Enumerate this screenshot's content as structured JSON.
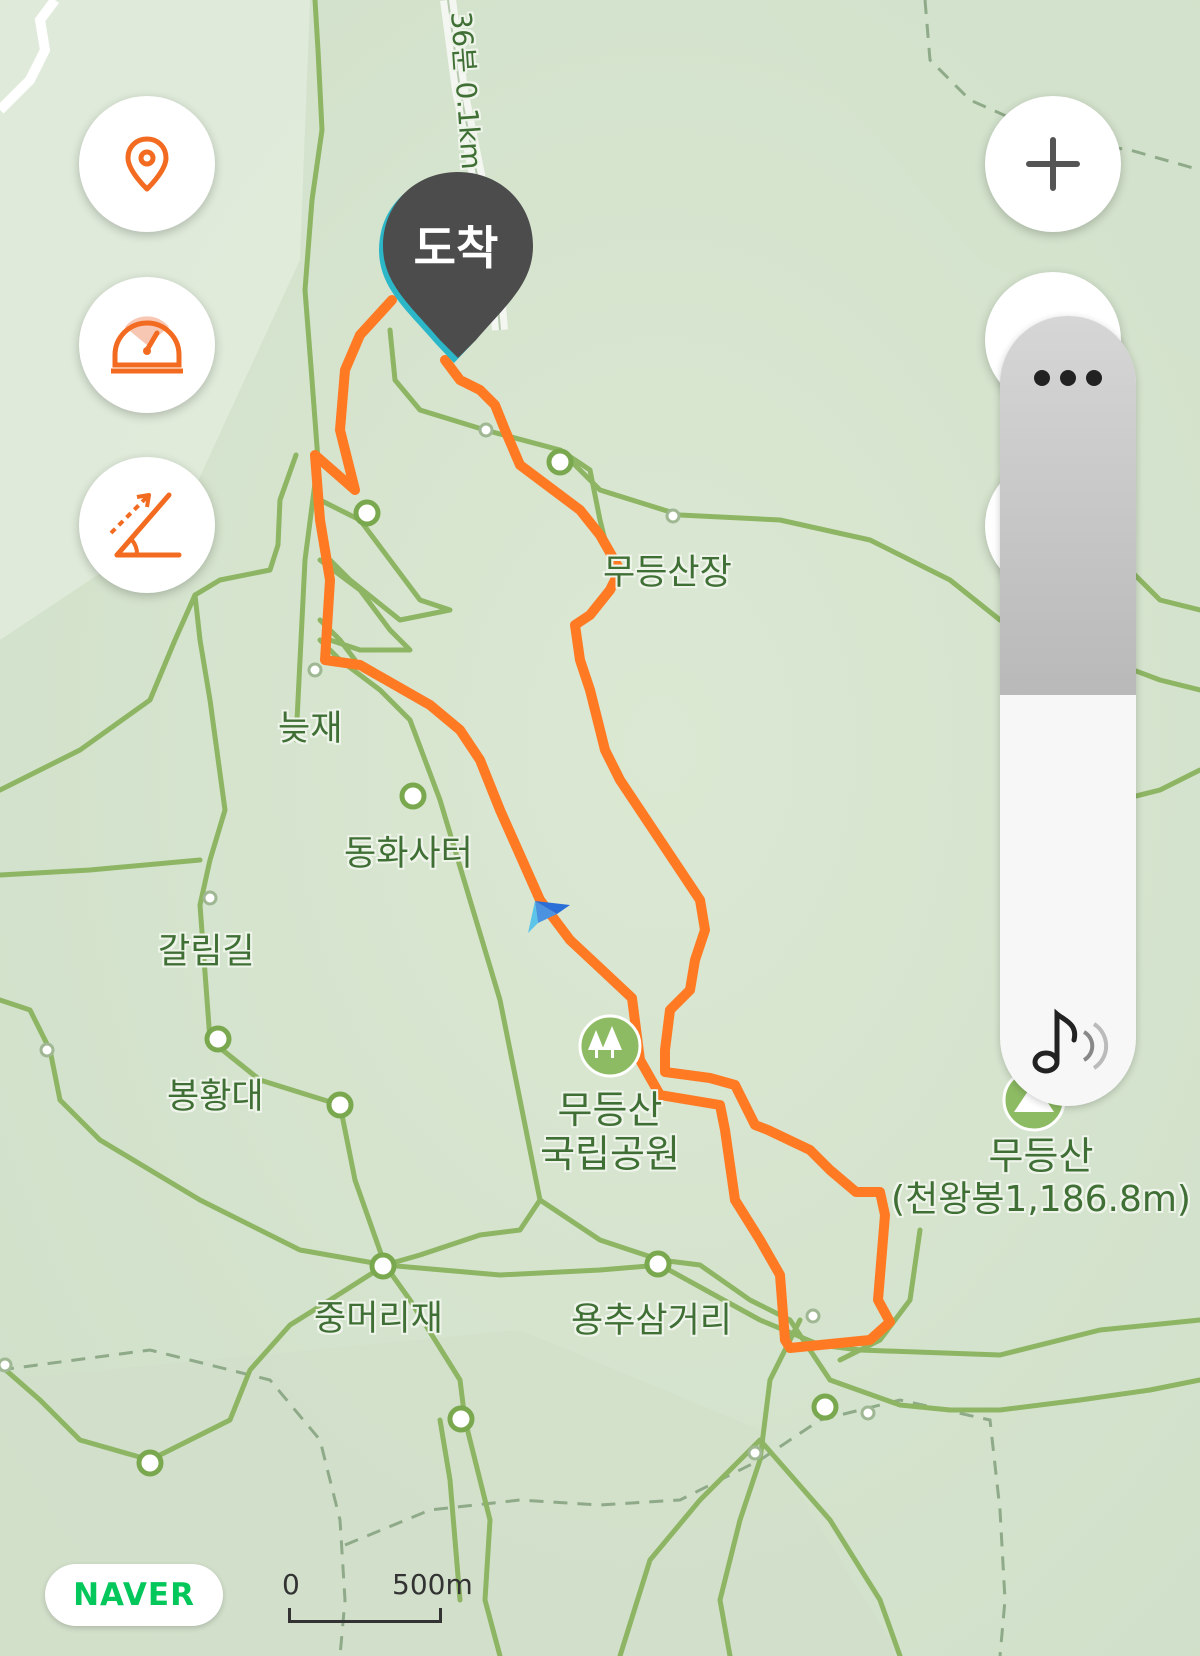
{
  "place_labels": {
    "mudeung_sanjang": "무등산장",
    "neutjae": "늦재",
    "donghwa_sateo": "동화사터",
    "galrimgil": "갈림길",
    "bonghwangdae": "봉황대",
    "park_line1": "무등산",
    "park_line2": "국립공원",
    "jungmeorijae": "중머리재",
    "yongchu_samgeori": "용추삼거리",
    "peak_name": "무등산",
    "peak_detail": "(천왕봉1,186.8m)",
    "road_label": "36분 0.1km"
  },
  "arrival_marker": {
    "label": "도착"
  },
  "volume": {
    "level": 0.48
  },
  "scale": {
    "zero": "0",
    "distance": "500m"
  },
  "logo": {
    "text": "NAVER"
  },
  "icons": {
    "location": "location-pin-icon",
    "speed": "speedometer-icon",
    "slope": "slope-angle-icon",
    "zoom": "plus-icon",
    "more": "more-dots-icon",
    "sound": "music-note-sound-icon",
    "park": "forest-park-icon",
    "peak": "mountain-peak-icon",
    "heading": "heading-arrow-icon"
  },
  "colors": {
    "route": "#ff7a22",
    "trail": "#8db563",
    "accent": "#f26b21",
    "map_bg": "#d8e5d2"
  }
}
